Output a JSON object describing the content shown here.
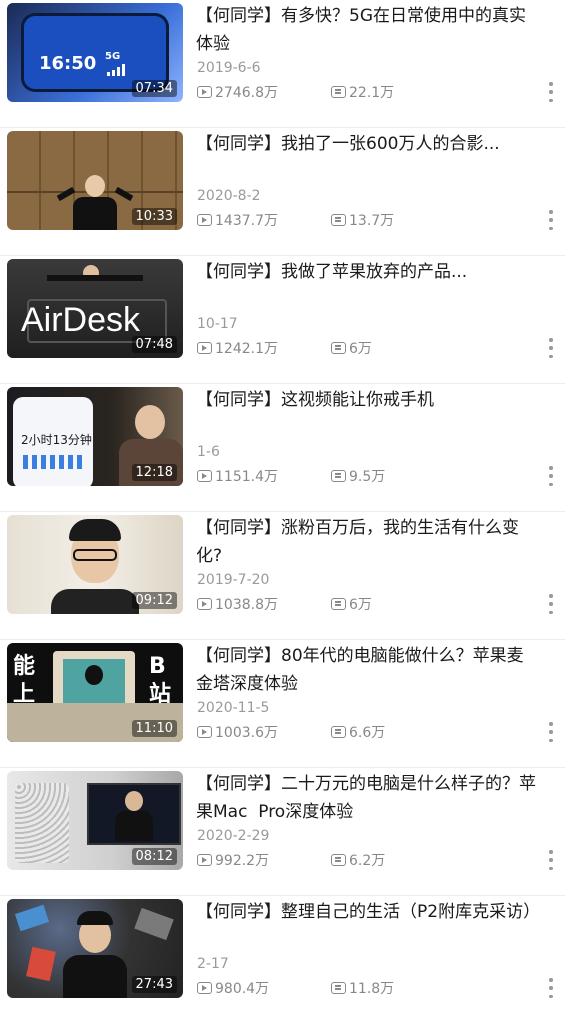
{
  "videos": [
    {
      "title": "【何同学】有多快？5G在日常使用中的真实体验",
      "date": "2019-6-6",
      "plays": "2746.8万",
      "danmaku": "22.1万",
      "duration": "07:34",
      "thumb_text": "16:50",
      "thumb_badge": "5G",
      "thumb_bg": "#3a6fd8"
    },
    {
      "title": "【何同学】我拍了一张600万人的合影...",
      "date": "2020-8-2",
      "plays": "1437.7万",
      "danmaku": "13.7万",
      "duration": "10:33",
      "thumb_bg": "#9c7a4f"
    },
    {
      "title": "【何同学】我做了苹果放弃的产品...",
      "date": "10-17",
      "plays": "1242.1万",
      "danmaku": "6万",
      "duration": "07:48",
      "thumb_text": "AirDesk",
      "thumb_bg": "#2b2b2b"
    },
    {
      "title": "【何同学】这视频能让你戒手机",
      "date": "1-6",
      "plays": "1151.4万",
      "danmaku": "9.5万",
      "duration": "12:18",
      "thumb_text": "2小时13分钟",
      "thumb_bg": "#1d2430"
    },
    {
      "title": "【何同学】涨粉百万后，我的生活有什么变化?",
      "date": "2019-7-20",
      "plays": "1038.8万",
      "danmaku": "6万",
      "duration": "09:12",
      "thumb_bg": "#d9d2c4"
    },
    {
      "title": "【何同学】80年代的电脑能做什么？苹果麦金塔深度体验",
      "date": "2020-11-5",
      "plays": "1003.6万",
      "danmaku": "6.6万",
      "duration": "11:10",
      "thumb_side_left": "能上",
      "thumb_side_right": "B站",
      "thumb_bg": "#111111"
    },
    {
      "title": "【何同学】二十万元的电脑是什么样子的？苹果Mac  Pro深度体验",
      "date": "2020-2-29",
      "plays": "992.2万",
      "danmaku": "6.2万",
      "duration": "08:12",
      "thumb_bg": "#cfcfcf"
    },
    {
      "title": "【何同学】整理自己的生活（P2附库克采访）",
      "date": "2-17",
      "plays": "980.4万",
      "danmaku": "11.8万",
      "duration": "27:43",
      "thumb_bg": "#3d3d3d"
    }
  ],
  "icons": {
    "play": "play-icon",
    "danmaku": "danmaku-icon",
    "more": "more-options-icon"
  },
  "colors": {
    "text": "#1a1a1a",
    "meta": "#9a9a9a",
    "bg": "#ffffff"
  }
}
